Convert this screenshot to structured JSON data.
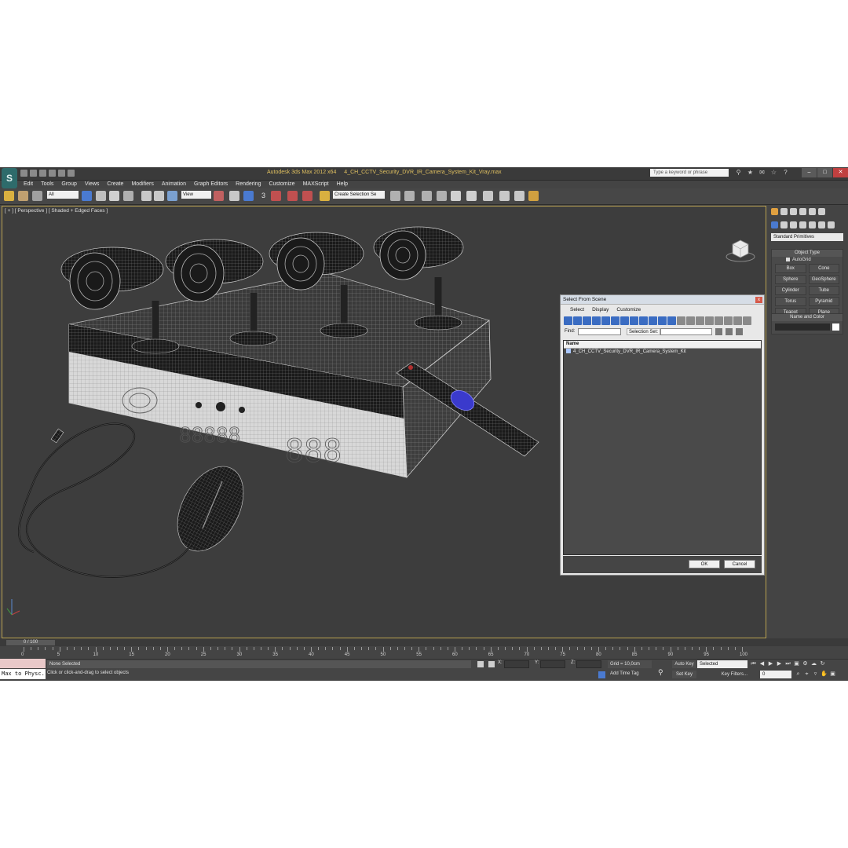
{
  "titlebar": {
    "app_logo": "S",
    "app_title": "Autodesk 3ds Max  2012 x64",
    "file_name": "4_CH_CCTV_Security_DVR_IR_Camera_System_Kit_Vray.max",
    "search_placeholder": "Type a keyword or phrase"
  },
  "menu": [
    "Edit",
    "Tools",
    "Group",
    "Views",
    "Create",
    "Modifiers",
    "Animation",
    "Graph Editors",
    "Rendering",
    "Customize",
    "MAXScript",
    "Help"
  ],
  "toolbar": {
    "selection_filter": "All",
    "ref_coord": "View",
    "snap_value": "3",
    "named_selection": "Create Selection Se"
  },
  "viewport": {
    "label": "[ + ] [ Perspective ] [ Shaded + Edged Faces ]"
  },
  "command_panel": {
    "category": "Standard Primitives",
    "object_type_title": "Object Type",
    "autogrid": "AutoGrid",
    "objects": [
      "Box",
      "Cone",
      "Sphere",
      "GeoSphere",
      "Cylinder",
      "Tube",
      "Torus",
      "Pyramid",
      "Teapot",
      "Plane"
    ],
    "name_color_title": "Name and Color"
  },
  "dialog": {
    "title": "Select From Scene",
    "close": "x",
    "menu": [
      "Select",
      "Display",
      "Customize"
    ],
    "find_label": "Find:",
    "selection_set_label": "Selection Set:",
    "column_name": "Name",
    "items": [
      "4_CH_CCTV_Security_DVR_IR_Camera_System_Kit"
    ],
    "ok": "OK",
    "cancel": "Cancel"
  },
  "timeline": {
    "slider": "0 / 100",
    "ticks": [
      "0",
      "5",
      "10",
      "15",
      "20",
      "25",
      "30",
      "35",
      "40",
      "45",
      "50",
      "55",
      "60",
      "65",
      "70",
      "75",
      "80",
      "85",
      "90",
      "95",
      "100"
    ]
  },
  "status": {
    "maxscript_listener": "Max to Physc.",
    "selection": "None Selected",
    "prompt": "Click or click-and-drag to select objects",
    "x_label": "X:",
    "y_label": "Y:",
    "z_label": "Z:",
    "grid": "Grid = 10,0cm",
    "add_time_tag": "Add Time Tag",
    "auto_key": "Auto Key",
    "set_key": "Set Key",
    "key_mode": "Selected",
    "key_filters": "Key Filters...",
    "frame": "0"
  },
  "colors": {
    "viewport_bg": "#3d3d3d",
    "active_border": "#b8a050",
    "title_text": "#e0c060",
    "dialog_bg": "#e8e8e8",
    "wire": "#c8c8c8",
    "remote_button": "#3a3acc"
  }
}
